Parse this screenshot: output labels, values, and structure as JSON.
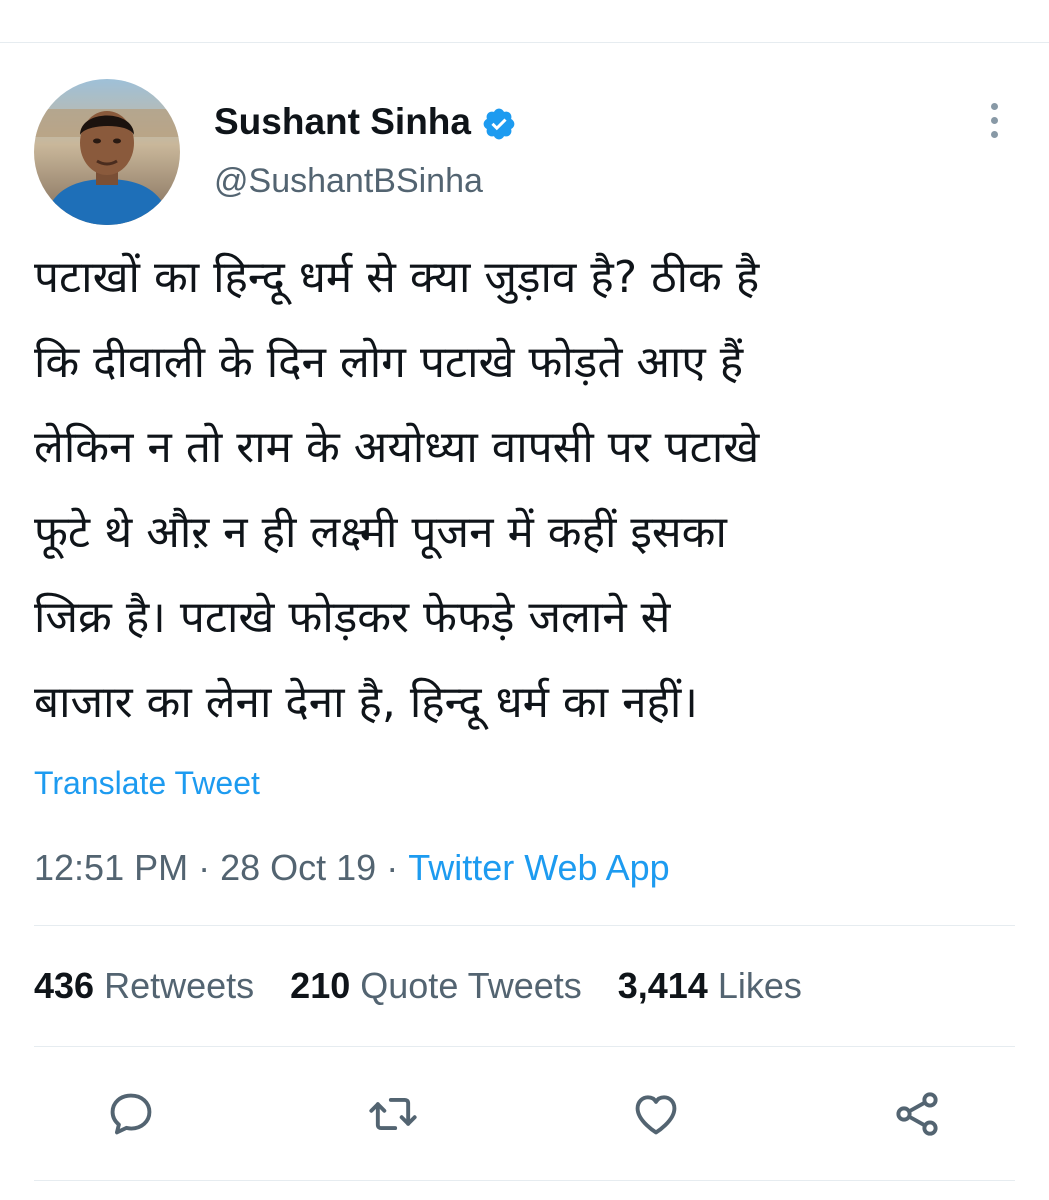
{
  "colors": {
    "link": "#1d9bf0",
    "secondary_text": "#536471",
    "verified_badge": "#1d9bf0",
    "icon": "#536471"
  },
  "author": {
    "display_name": "Sushant Sinha",
    "handle": "@SushantBSinha",
    "verified_icon": "verified-badge-icon",
    "avatar": "profile-photo"
  },
  "tweet": {
    "text": "पटाखों का हिन्दू धर्म से क्या जुड़ाव है? ठीक है\nकि दीवाली के दिन लोग पटाखे फोड़ते आए हैं\nलेकिन न तो राम के अयोध्या वापसी पर पटाखे\nफूटे थे औऱ न ही लक्ष्मी पूजन में कहीं इसका\nजिक्र है। पटाखे फोड़कर फेफड़े जलाने से\nबाजार का लेना देना है, हिन्दू धर्म का नहीं।",
    "translate_label": "Translate Tweet",
    "time": "12:51 PM",
    "date": "28 Oct 19",
    "separator": "·",
    "source": "Twitter Web App"
  },
  "stats": {
    "retweets_count": "436",
    "retweets_label": "Retweets",
    "quote_count": "210",
    "quote_label": "Quote Tweets",
    "likes_count": "3,414",
    "likes_label": "Likes"
  },
  "actions": {
    "reply_icon": "reply-icon",
    "retweet_icon": "retweet-icon",
    "like_icon": "heart-icon",
    "share_icon": "share-icon",
    "more_icon": "more-vertical-icon"
  }
}
